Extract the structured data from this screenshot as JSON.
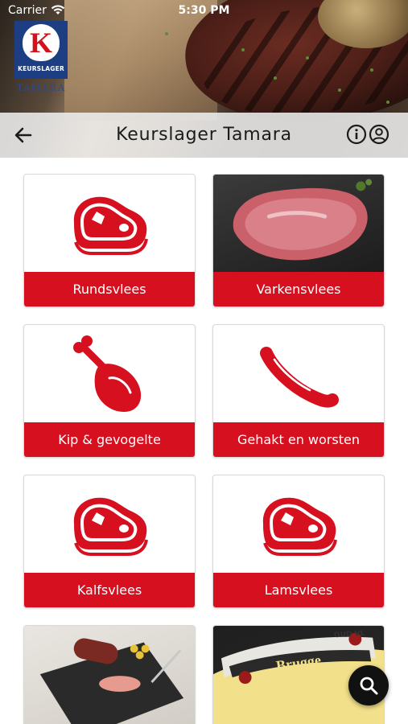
{
  "status_bar": {
    "carrier": "Carrier",
    "time": "5:30 PM"
  },
  "header": {
    "logo": {
      "letter": "K",
      "brand": "KEURSLAGER",
      "subname": "TAMARA"
    },
    "title": "Keurslager Tamara"
  },
  "categories": [
    {
      "label": "Rundsvlees",
      "icon": "meat-steak-icon"
    },
    {
      "label": "Varkensvlees",
      "icon": "pork-photo"
    },
    {
      "label": "Kip & gevogelte",
      "icon": "chicken-leg-icon"
    },
    {
      "label": "Gehakt en worsten",
      "icon": "sausage-icon"
    },
    {
      "label": "Kalfsvlees",
      "icon": "meat-steak-icon"
    },
    {
      "label": "Lamsvlees",
      "icon": "meat-steak-icon"
    }
  ],
  "partial_tiles": [
    {
      "icon": "charcuterie-photo"
    },
    {
      "icon": "cheese-photo",
      "cheese_text": "Brugge",
      "cheese_band": "OUD VL"
    }
  ],
  "colors": {
    "accent": "#d6101f",
    "logo_blue": "#1e3e84",
    "navbar": "#eeeeee"
  }
}
